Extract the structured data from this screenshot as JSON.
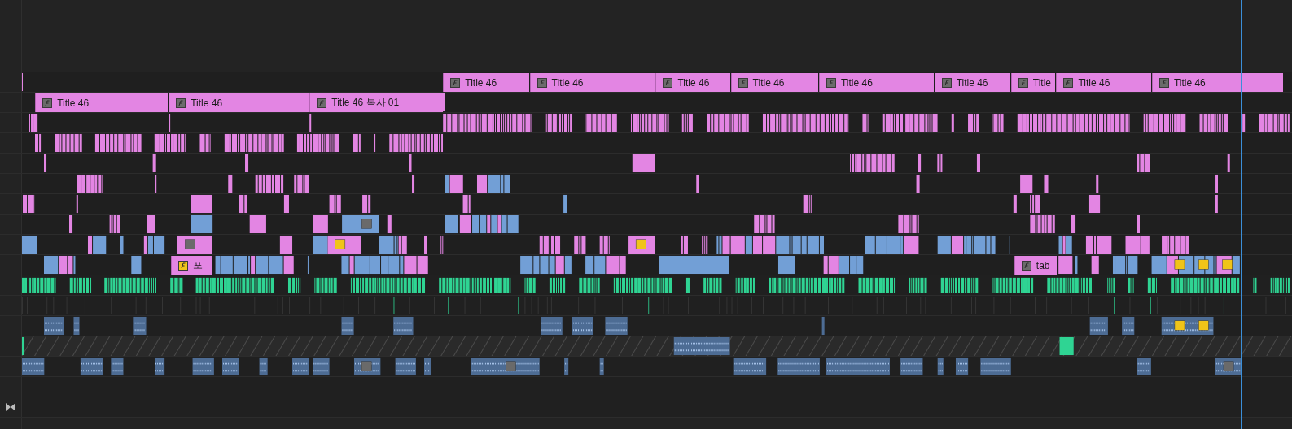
{
  "timeline": {
    "tracks": [
      {
        "kind": "video",
        "clips": [
          {
            "label": "Title 46",
            "fx_active": false
          },
          {
            "label": "Title 46",
            "fx_active": false
          },
          {
            "label": "Title 46",
            "fx_active": false
          },
          {
            "label": "Title 46",
            "fx_active": false
          },
          {
            "label": "Title 46",
            "fx_active": false
          },
          {
            "label": "Title 46",
            "fx_active": false
          },
          {
            "label": "Title",
            "fx_active": false
          },
          {
            "label": "Title 46",
            "fx_active": false
          },
          {
            "label": "Title 46",
            "fx_active": false
          }
        ]
      },
      {
        "kind": "video",
        "clips": [
          {
            "label": "Title 46",
            "fx_active": false
          },
          {
            "label": "Title 46",
            "fx_active": false
          },
          {
            "label": "Title 46 복사 01",
            "fx_active": false
          }
        ]
      },
      {
        "kind": "video"
      },
      {
        "kind": "video"
      },
      {
        "kind": "video"
      },
      {
        "kind": "video"
      },
      {
        "kind": "video"
      },
      {
        "kind": "video"
      },
      {
        "kind": "video"
      },
      {
        "kind": "video",
        "clips": [
          {
            "label": "포",
            "fx_active": true
          },
          {
            "label": "tab",
            "fx_active": false
          }
        ]
      },
      {
        "kind": "audio"
      },
      {
        "kind": "audio"
      },
      {
        "kind": "audio"
      },
      {
        "kind": "locked"
      },
      {
        "kind": "audio"
      },
      {
        "kind": "audio"
      },
      {
        "kind": "audio"
      }
    ]
  }
}
